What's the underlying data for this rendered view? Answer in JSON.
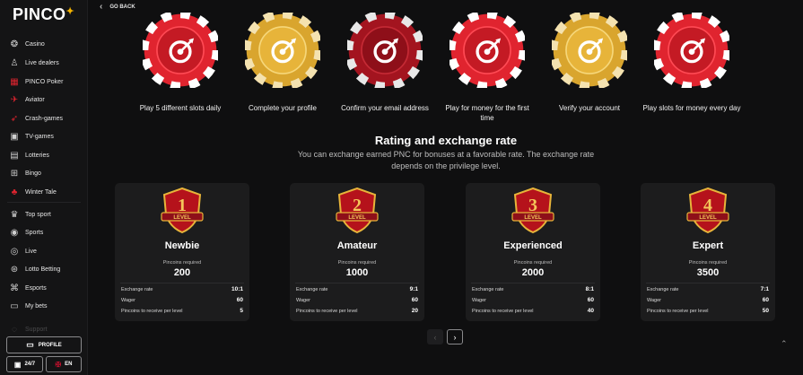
{
  "brand": {
    "logo": "PINCO",
    "star": "✦"
  },
  "sidebar": {
    "items": [
      {
        "label": "Casino",
        "icon": "casino-chip-icon"
      },
      {
        "label": "Live dealers",
        "icon": "live-dealer-icon"
      },
      {
        "label": "PINCO Poker",
        "icon": "poker-icon"
      },
      {
        "label": "Aviator",
        "icon": "airplane-icon"
      },
      {
        "label": "Crash-games",
        "icon": "rocket-icon"
      },
      {
        "label": "TV-games",
        "icon": "tv-icon"
      },
      {
        "label": "Lotteries",
        "icon": "lottery-icon"
      },
      {
        "label": "Bingo",
        "icon": "bingo-icon"
      },
      {
        "label": "Winter Tale",
        "icon": "tree-icon"
      },
      {
        "label": "Top sport",
        "icon": "trophy-icon"
      },
      {
        "label": "Sports",
        "icon": "soccer-ball-icon"
      },
      {
        "label": "Live",
        "icon": "live-icon"
      },
      {
        "label": "Lotto Betting",
        "icon": "lotto-ball-icon"
      },
      {
        "label": "Esports",
        "icon": "gamepad-icon"
      },
      {
        "label": "My bets",
        "icon": "ticket-icon"
      },
      {
        "label": "Support",
        "icon": "support-icon"
      }
    ],
    "profile_label": "PROFILE",
    "support_label": "24/7",
    "lang_label": "EN"
  },
  "header": {
    "go_back": "GO BACK"
  },
  "tasks": [
    {
      "label": "Play 5 different slots daily",
      "color": "red"
    },
    {
      "label": "Complete your profile",
      "color": "gold"
    },
    {
      "label": "Confirm your email address",
      "color": "darkred"
    },
    {
      "label": "Play for money for the first time",
      "color": "red"
    },
    {
      "label": "Verify your account",
      "color": "gold"
    },
    {
      "label": "Play slots for money every day",
      "color": "red"
    }
  ],
  "rating": {
    "title": "Rating and exchange rate",
    "description": "You can exchange earned PNC for bonuses at a favorable rate. The exchange rate depends on the privilege level."
  },
  "levels": [
    {
      "number": "1",
      "badge_text": "LEVEL",
      "name": "Newbie",
      "req_label": "Pincoins required",
      "req_value": "200",
      "exchange_label": "Exchange rate",
      "exchange": "10:1",
      "wager_label": "Wager",
      "wager": "60",
      "per_level_label": "Pincoins to receive per level",
      "per_level": "5"
    },
    {
      "number": "2",
      "badge_text": "LEVEL",
      "name": "Amateur",
      "req_label": "Pincoins required",
      "req_value": "1000",
      "exchange_label": "Exchange rate",
      "exchange": "9:1",
      "wager_label": "Wager",
      "wager": "60",
      "per_level_label": "Pincoins to receive per level",
      "per_level": "20"
    },
    {
      "number": "3",
      "badge_text": "LEVEL",
      "name": "Experienced",
      "req_label": "Pincoins required",
      "req_value": "2000",
      "exchange_label": "Exchange rate",
      "exchange": "8:1",
      "wager_label": "Wager",
      "wager": "60",
      "per_level_label": "Pincoins to receive per level",
      "per_level": "40"
    },
    {
      "number": "4",
      "badge_text": "LEVEL",
      "name": "Expert",
      "req_label": "Pincoins required",
      "req_value": "3500",
      "exchange_label": "Exchange rate",
      "exchange": "7:1",
      "wager_label": "Wager",
      "wager": "60",
      "per_level_label": "Pincoins to receive per level",
      "per_level": "50"
    }
  ],
  "pager": {
    "prev": "‹",
    "next": "›"
  },
  "scroll_top": "⌃",
  "colors": {
    "red": "#e0242f",
    "gold": "#e7b43a",
    "darkred": "#a3141f",
    "bg": "#0f0f10",
    "card": "#1c1c1d"
  }
}
